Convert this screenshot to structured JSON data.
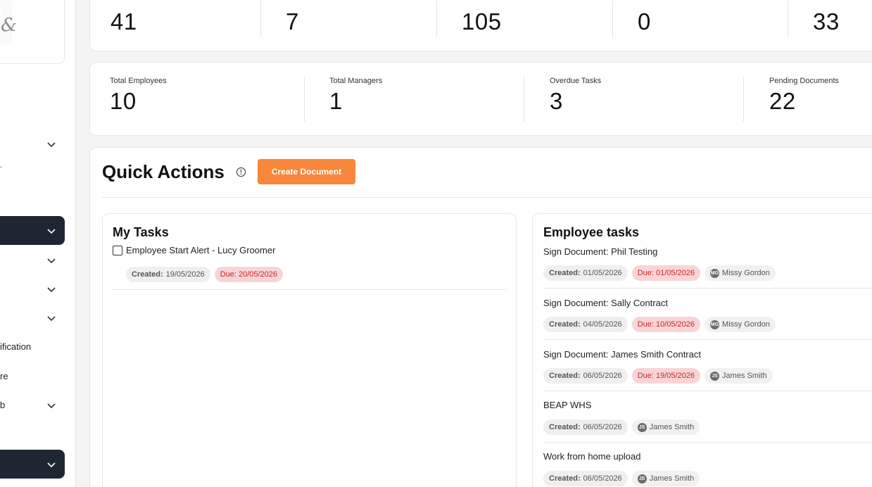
{
  "sidebar": {
    "items": [
      {
        "label": ""
      },
      {
        "label": ""
      },
      {
        "label": ""
      },
      {
        "label": ""
      },
      {
        "label": "ification"
      },
      {
        "label": "re"
      },
      {
        "label": "b"
      },
      {
        "label": ""
      }
    ]
  },
  "stats_top": [
    {
      "value": "41"
    },
    {
      "value": "7"
    },
    {
      "value": "105"
    },
    {
      "value": "0"
    },
    {
      "value": "33"
    }
  ],
  "stats_mid": [
    {
      "label": "Total Employees",
      "value": "10"
    },
    {
      "label": "Total Managers",
      "value": "1"
    },
    {
      "label": "Overdue Tasks",
      "value": "3"
    },
    {
      "label": "Pending Documents",
      "value": "22"
    }
  ],
  "quick_actions": {
    "title": "Quick Actions",
    "create_label": "Create Document"
  },
  "my_tasks": {
    "title": "My Tasks",
    "tasks": [
      {
        "name": "Employee Start Alert - Lucy Groomer",
        "created_label": "Created:",
        "created": "19/05/2026",
        "due": "Due: 20/05/2026"
      }
    ]
  },
  "employee_tasks": {
    "title": "Employee tasks",
    "tasks": [
      {
        "name": "Sign Document: Phil Testing",
        "created_label": "Created:",
        "created": "01/05/2026",
        "due": "Due: 01/05/2026",
        "initials": "MG",
        "assignee": "Missy Gordon"
      },
      {
        "name": "Sign Document: Sally Contract",
        "created_label": "Created:",
        "created": "04/05/2026",
        "due": "Due: 10/05/2026",
        "initials": "MG",
        "assignee": "Missy Gordon"
      },
      {
        "name": "Sign Document: James Smith Contract",
        "created_label": "Created:",
        "created": "06/05/2026",
        "due": "Due: 19/05/2026",
        "initials": "JS",
        "assignee": "James Smith"
      },
      {
        "name": "BEAP WHS",
        "created_label": "Created:",
        "created": "06/05/2026",
        "initials": "JS",
        "assignee": "James Smith"
      },
      {
        "name": "Work from home upload",
        "created_label": "Created:",
        "created": "06/05/2026",
        "initials": "JS",
        "assignee": "James Smith"
      }
    ]
  },
  "colors": {
    "accent": "#f7873a",
    "sidebar_active": "#1f2633",
    "due_bg": "#f9d4d6",
    "due_text": "#c62828"
  }
}
